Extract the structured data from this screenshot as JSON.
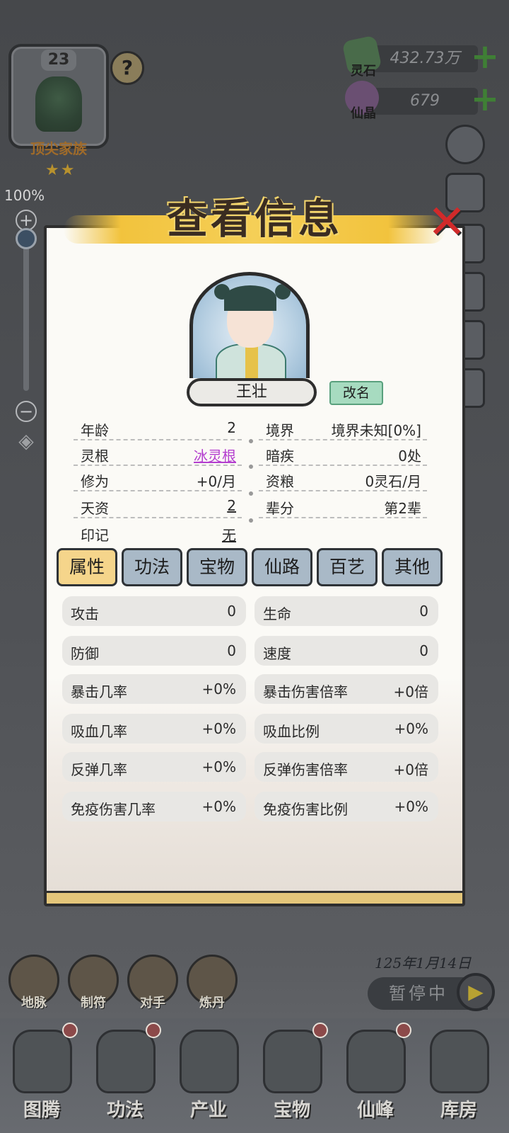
{
  "family": {
    "level": "23",
    "rank": "顶尖家族",
    "stars": "★★",
    "help_icon": "?"
  },
  "resources": {
    "spirit_stone": {
      "label": "灵石",
      "value": "432.73万",
      "plus": "+"
    },
    "crystal": {
      "label": "仙晶",
      "value": "679",
      "plus": "+"
    }
  },
  "zoom": {
    "percent": "100%",
    "plus": "+",
    "minus": "−",
    "level": 1.0
  },
  "dialog": {
    "title": "查看信息",
    "close_icon": "✕",
    "name": "王壮",
    "rename_label": "改名",
    "info_left": [
      {
        "key": "年龄",
        "value": "2"
      },
      {
        "key": "灵根",
        "value": "冰灵根"
      },
      {
        "key": "修为",
        "value": "+0/月"
      },
      {
        "key": "天资",
        "value": "2"
      },
      {
        "key": "印记",
        "value": "无"
      }
    ],
    "info_right": [
      {
        "key": "境界",
        "value": "境界未知[0%]"
      },
      {
        "key": "暗疾",
        "value": "0处"
      },
      {
        "key": "资粮",
        "value": "0灵石/月"
      },
      {
        "key": "辈分",
        "value": "第2辈"
      }
    ],
    "tabs": [
      "属性",
      "功法",
      "宝物",
      "仙路",
      "百艺",
      "其他"
    ],
    "stats_left": [
      {
        "key": "攻击",
        "value": "0"
      },
      {
        "key": "防御",
        "value": "0"
      },
      {
        "key": "暴击几率",
        "value": "+0%"
      },
      {
        "key": "吸血几率",
        "value": "+0%"
      },
      {
        "key": "反弹几率",
        "value": "+0%"
      },
      {
        "key": "免疫伤害几率",
        "value": "+0%"
      }
    ],
    "stats_right": [
      {
        "key": "生命",
        "value": "0"
      },
      {
        "key": "速度",
        "value": "0"
      },
      {
        "key": "暴击伤害倍率",
        "value": "+0倍"
      },
      {
        "key": "吸血比例",
        "value": "+0%"
      },
      {
        "key": "反弹伤害倍率",
        "value": "+0倍"
      },
      {
        "key": "免疫伤害比例",
        "value": "+0%"
      }
    ]
  },
  "game_date": "125年1月14日",
  "pause": {
    "label": "暂停中",
    "play_icon": "▶"
  },
  "quick_actions": [
    "地脉",
    "制符",
    "对手",
    "炼丹"
  ],
  "nav": [
    "图腾",
    "功法",
    "产业",
    "宝物",
    "仙峰",
    "库房"
  ],
  "colors": {
    "accent_gold": "#f5d58b",
    "tab_default": "#a9b9c7",
    "link_purple": "#b43fcf",
    "rename_green": "#a7dbc0",
    "close_red": "#d12a2a"
  }
}
